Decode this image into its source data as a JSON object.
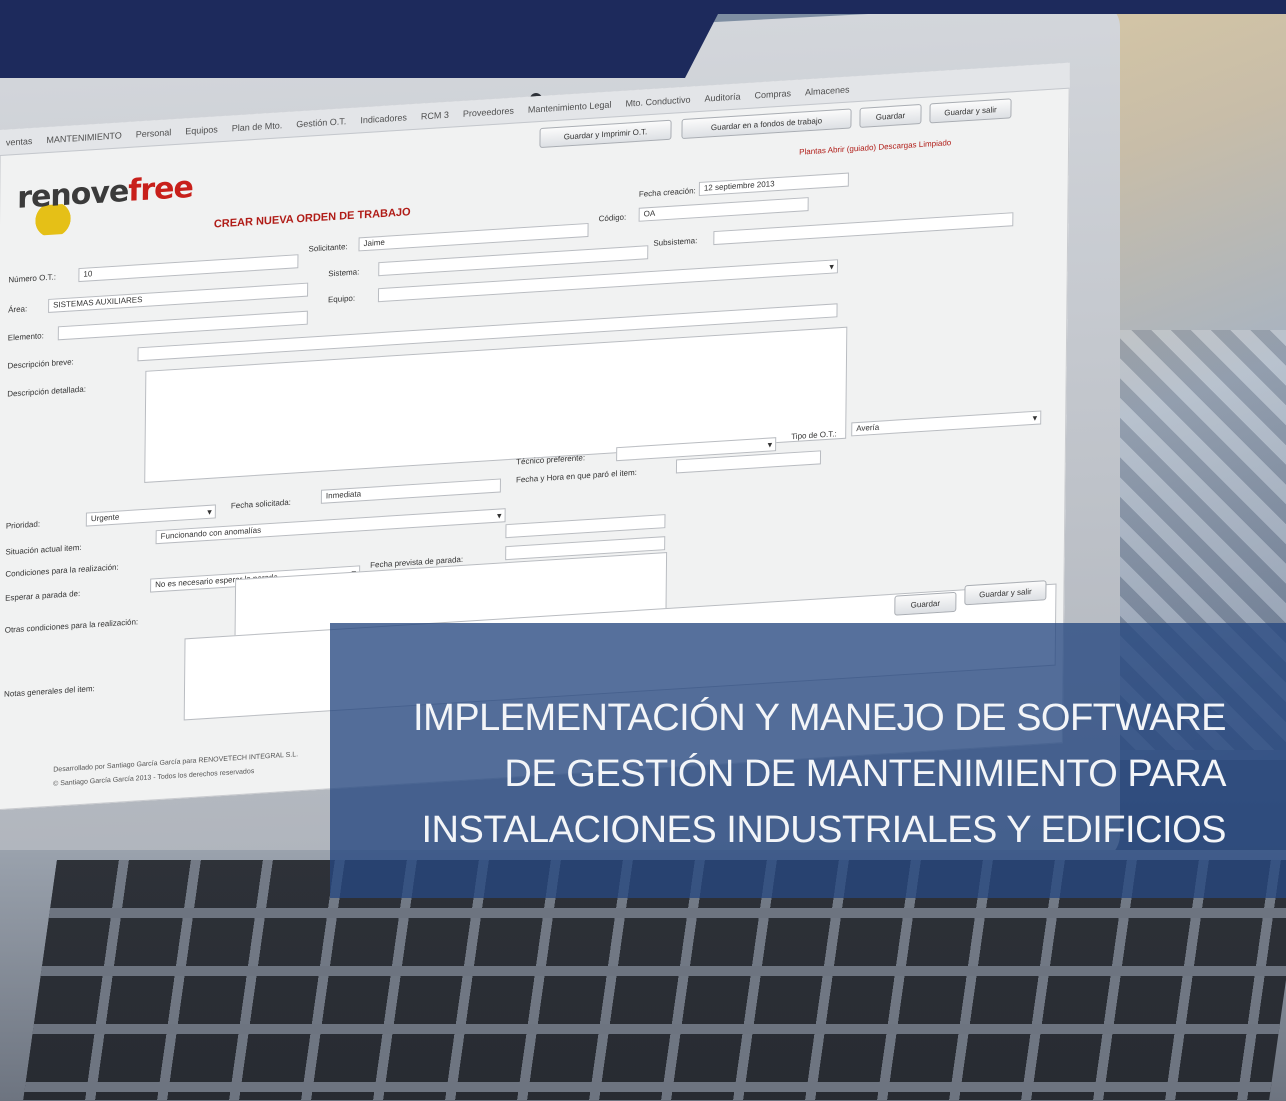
{
  "colors": {
    "band": "#1d2a5c",
    "accent_red": "#b01c17",
    "overlay": "#264880"
  },
  "app": {
    "menu": [
      "ventas",
      "MANTENIMIENTO",
      "Personal",
      "Equipos",
      "Plan de Mto.",
      "Gestión O.T.",
      "Indicadores",
      "RCM 3",
      "Proveedores",
      "Mantenimiento Legal",
      "Mto. Conductivo",
      "Auditoría",
      "Compras",
      "Almacenes"
    ],
    "toolbar": {
      "btn1": "Guardar y Imprimir O.T.",
      "btn2": "Guardar en a fondos de trabajo",
      "btn3": "Guardar",
      "btn4": "Guardar y salir"
    },
    "logo_dark": "renove",
    "logo_red": "free",
    "header_links": "Plantas   Abrir (guiado)   Descargas   Limpiado",
    "form_title": "CREAR NUEVA ORDEN DE TRABAJO",
    "labels": {
      "num_ot": "Número O.T.:",
      "solicitante": "Solicitante:",
      "codigo": "Código:",
      "fecha_creacion": "Fecha creación:",
      "subsistema": "Subsistema:",
      "sistema": "Sistema:",
      "area": "Área:",
      "equipo": "Equipo:",
      "elemento": "Elemento:",
      "desc_breve": "Descripción breve:",
      "desc_detallada": "Descripción detallada:",
      "tecnico": "Técnico preferente:",
      "tipo_ot": "Tipo de O.T.:",
      "prioridad": "Prioridad:",
      "fecha_solicitada": "Fecha solicitada:",
      "fecha_hora": "Fecha y Hora en que paró el item:",
      "situacion": "Situación actual item:",
      "condiciones": "Condiciones para la realización:",
      "esperar": "Esperar a parada de:",
      "fecha_prevista": "Fecha prevista de parada:",
      "otras": "Otras condiciones para la realización:",
      "notas": "Notas generales del item:"
    },
    "values": {
      "num_ot": "10",
      "solicitante": "Jaime",
      "codigo": "OA",
      "area": "SISTEMAS AUXILIARES",
      "tipo_ot": "Avería",
      "prioridad": "Urgente",
      "fecha_solicitada": "Inmediata",
      "situacion": "Funcionando con anomalías",
      "esperar": "No es necesario esperar la parada",
      "fecha_creacion": "12 septiembre 2013"
    },
    "footer": {
      "line1": "Desarrollado por Santiago García García para RENOVETECH INTEGRAL S.L.",
      "line2": "© Santiago García García 2013 - Todos los derechos reservados"
    },
    "bottom_buttons": {
      "b1": "Guardar",
      "b2": "Guardar y salir"
    }
  },
  "headline": {
    "line1": "IMPLEMENTACIÓN Y MANEJO DE SOFTWARE",
    "line2": "DE GESTIÓN DE MANTENIMIENTO PARA",
    "line3": "INSTALACIONES INDUSTRIALES Y EDIFICIOS"
  }
}
